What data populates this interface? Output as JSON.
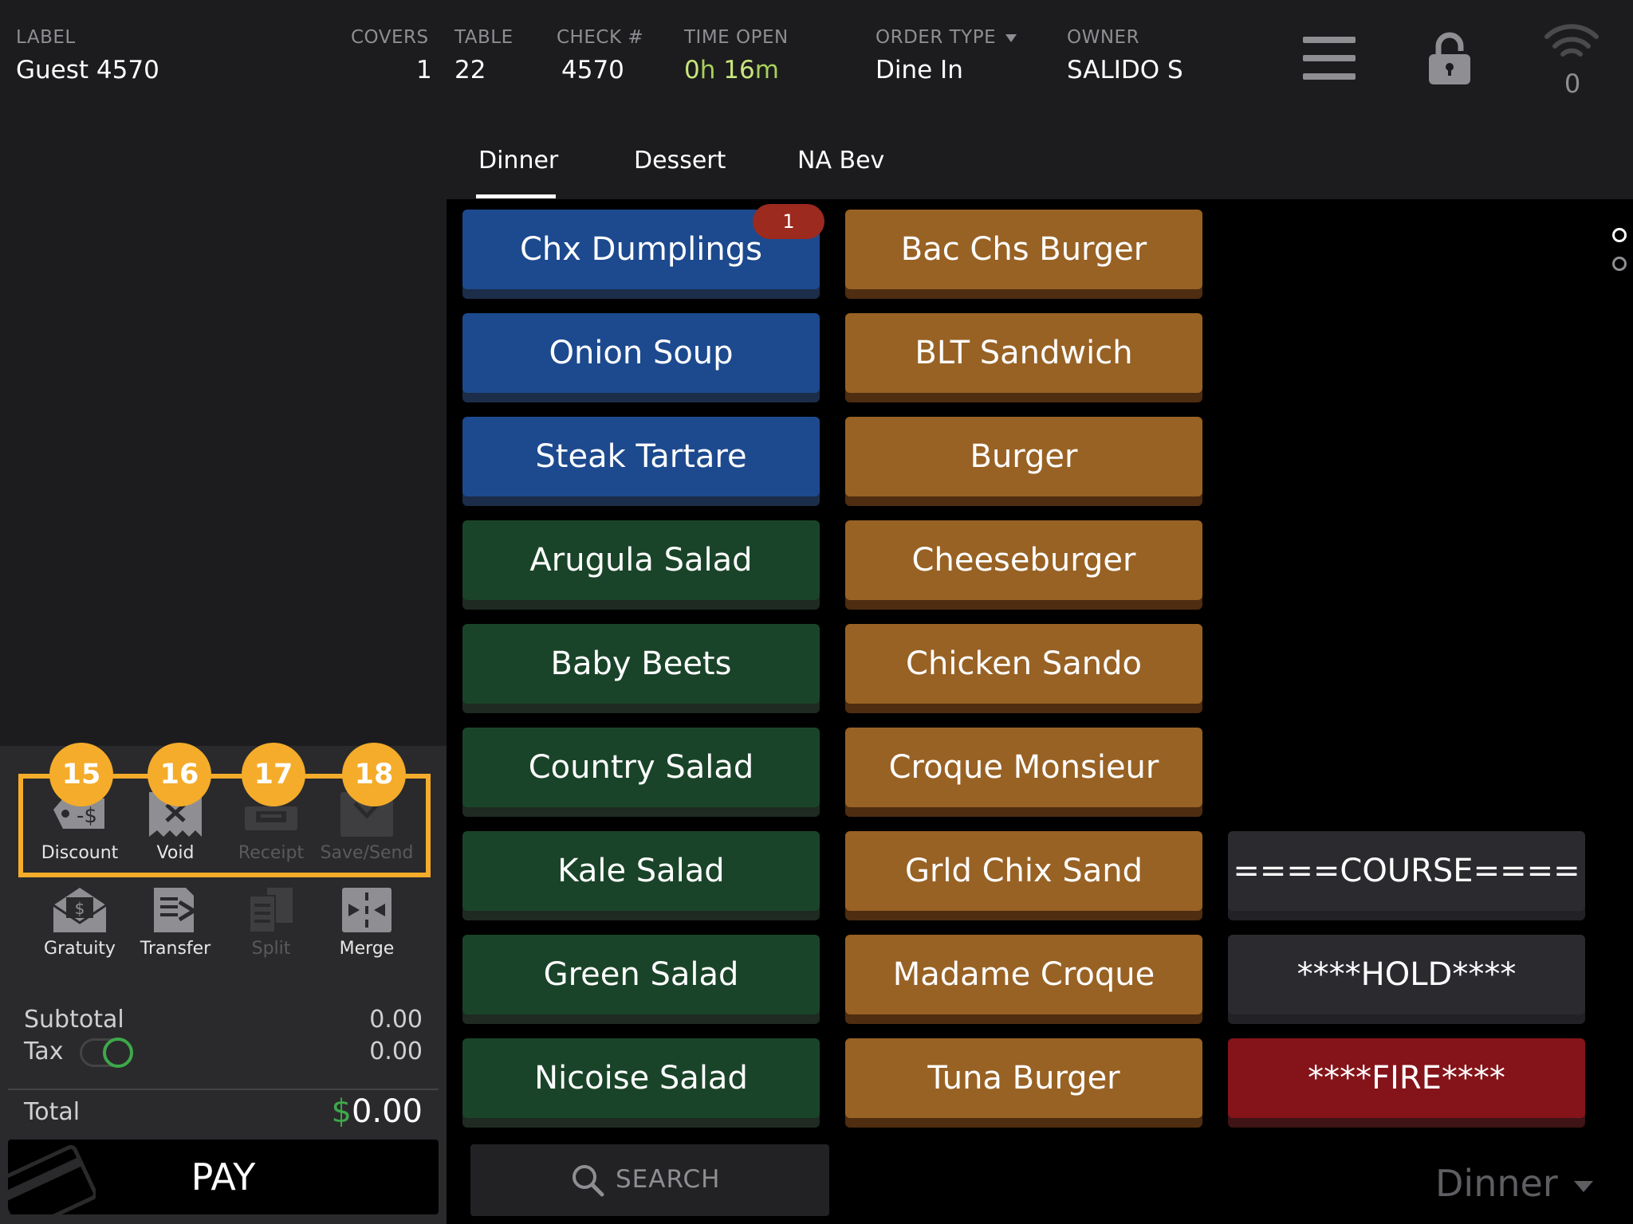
{
  "header": {
    "label": {
      "title": "LABEL",
      "value": "Guest 4570"
    },
    "covers": {
      "title": "COVERS",
      "value": "1"
    },
    "table": {
      "title": "TABLE",
      "value": "22"
    },
    "check": {
      "title": "CHECK #",
      "value": "4570"
    },
    "time_open": {
      "title": "TIME OPEN",
      "hours": "0",
      "hours_unit": "h",
      "minutes": "16",
      "minutes_unit": "m"
    },
    "order_type": {
      "title": "ORDER TYPE",
      "value": "Dine In"
    },
    "owner": {
      "title": "OWNER",
      "value": "SALIDO S"
    },
    "wifi_count": "0",
    "icons": {
      "menu": "hamburger-menu-icon",
      "lock": "lock-icon",
      "wifi": "wifi-icon"
    }
  },
  "tools": {
    "row1": [
      {
        "label": "Discount",
        "icon": "discount-tag-icon",
        "enabled": true,
        "callout": "15"
      },
      {
        "label": "Void",
        "icon": "void-receipt-icon",
        "enabled": true,
        "callout": "16"
      },
      {
        "label": "Receipt",
        "icon": "receipt-printer-icon",
        "enabled": false,
        "callout": "17"
      },
      {
        "label": "Save/Send",
        "icon": "save-send-icon",
        "enabled": false,
        "callout": "18"
      }
    ],
    "row2": [
      {
        "label": "Gratuity",
        "icon": "gratuity-envelope-icon",
        "enabled": true
      },
      {
        "label": "Transfer",
        "icon": "transfer-icon",
        "enabled": true
      },
      {
        "label": "Split",
        "icon": "split-icon",
        "enabled": false
      },
      {
        "label": "Merge",
        "icon": "merge-icon",
        "enabled": true
      }
    ]
  },
  "summary": {
    "subtotal_label": "Subtotal",
    "subtotal": "0.00",
    "tax_label": "Tax",
    "tax": "0.00",
    "tax_enabled": true,
    "total_label": "Total",
    "currency": "$",
    "total": "0.00"
  },
  "pay_label": "PAY",
  "tabs": [
    {
      "label": "Dinner",
      "active": true
    },
    {
      "label": "Dessert",
      "active": false
    },
    {
      "label": "NA Bev",
      "active": false
    }
  ],
  "menu_items": {
    "col1": [
      {
        "label": "Chx Dumplings",
        "color": "blue",
        "count": "1"
      },
      {
        "label": "Onion Soup",
        "color": "blue"
      },
      {
        "label": "Steak Tartare",
        "color": "blue"
      },
      {
        "label": "Arugula Salad",
        "color": "green"
      },
      {
        "label": "Baby Beets",
        "color": "green"
      },
      {
        "label": "Country Salad",
        "color": "green"
      },
      {
        "label": "Kale Salad",
        "color": "green"
      },
      {
        "label": "Green Salad",
        "color": "green"
      },
      {
        "label": "Nicoise Salad",
        "color": "green"
      }
    ],
    "col2": [
      {
        "label": "Bac Chs Burger"
      },
      {
        "label": "BLT Sandwich"
      },
      {
        "label": "Burger"
      },
      {
        "label": "Cheeseburger"
      },
      {
        "label": "Chicken Sando"
      },
      {
        "label": "Croque Monsieur"
      },
      {
        "label": "Grld Chix Sand"
      },
      {
        "label": "Madame Croque"
      },
      {
        "label": "Tuna Burger"
      }
    ],
    "col3": [
      {
        "label": "====COURSE====",
        "color": "dark"
      },
      {
        "label": "****HOLD****",
        "color": "dark"
      },
      {
        "label": "****FIRE****",
        "color": "red"
      }
    ]
  },
  "colors": {
    "blue": "#1d4a8e",
    "green": "#1a4429",
    "amber": "#986225",
    "red": "#84141a",
    "callout": "#f4ac2a",
    "toggle_on": "#3ea84a"
  },
  "search": {
    "placeholder": "SEARCH",
    "icon": "search-icon"
  },
  "menu_selector": {
    "value": "Dinner"
  },
  "pagination": {
    "pages": 2,
    "current": 1
  }
}
